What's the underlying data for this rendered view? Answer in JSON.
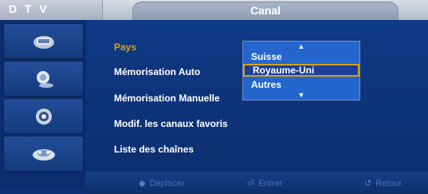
{
  "header": {
    "mode_label": "D T V",
    "title": "Canal"
  },
  "sidebar": {
    "items": [
      {
        "icon": "picture-icon"
      },
      {
        "icon": "sound-icon"
      },
      {
        "icon": "channel-icon"
      },
      {
        "icon": "setup-icon"
      }
    ]
  },
  "menu": {
    "items": [
      {
        "label": "Pays",
        "selected": true
      },
      {
        "label": "Mémorisation Auto"
      },
      {
        "label": "Mémorisation Manuelle"
      },
      {
        "label": "Modif. les canaux favoris"
      },
      {
        "label": "Liste des chaînes"
      }
    ]
  },
  "dropdown": {
    "up_arrow": "▲",
    "down_arrow": "▼",
    "options": [
      "Suisse",
      "Royaume-Uni",
      "Autres"
    ],
    "selected": "Royaume-Uni"
  },
  "help": {
    "move_icon": "◆",
    "move_label": "Déplacer",
    "enter_icon": "⏎",
    "enter_label": "Entrer",
    "return_icon": "↺",
    "return_label": "Retour"
  },
  "colors": {
    "background": "#0d2f74",
    "selected_text": "#d5a21a",
    "dropdown_bg": "#2466ce"
  }
}
